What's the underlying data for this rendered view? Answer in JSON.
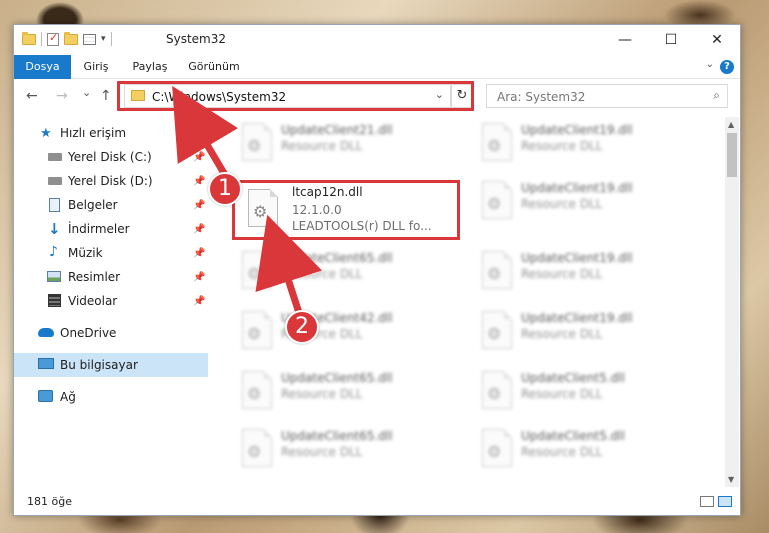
{
  "window": {
    "title": "System32"
  },
  "titlebar": {
    "minimize_glyph": "—",
    "maximize_glyph": "☐",
    "close_glyph": "✕"
  },
  "ribbon": {
    "tabs": [
      "Dosya",
      "Giriş",
      "Paylaş",
      "Görünüm"
    ],
    "help_glyph": "?"
  },
  "nav": {
    "back_glyph": "←",
    "forward_glyph": "→",
    "recent_glyph": "⌄",
    "up_glyph": "↑",
    "address": "C:\\Windows\\System32",
    "address_dropdown_glyph": "⌄",
    "refresh_glyph": "↻",
    "search_placeholder": "Ara: System32",
    "search_glyph": "⌕"
  },
  "sidebar": {
    "items": [
      {
        "label": "Hızlı erişim",
        "icon": "star-icon",
        "pinned": false
      },
      {
        "label": "Yerel Disk (C:)",
        "icon": "drive-icon",
        "pinned": true
      },
      {
        "label": "Yerel Disk (D:)",
        "icon": "drive-icon",
        "pinned": true
      },
      {
        "label": "Belgeler",
        "icon": "documents-icon",
        "pinned": true
      },
      {
        "label": "İndirmeler",
        "icon": "download-icon",
        "pinned": true
      },
      {
        "label": "Müzik",
        "icon": "music-icon",
        "pinned": true
      },
      {
        "label": "Resimler",
        "icon": "pictures-icon",
        "pinned": true
      },
      {
        "label": "Videolar",
        "icon": "videos-icon",
        "pinned": true
      },
      {
        "label": "OneDrive",
        "icon": "cloud-icon",
        "pinned": false
      },
      {
        "label": "Bu bilgisayar",
        "icon": "computer-icon",
        "pinned": false,
        "selected": true
      },
      {
        "label": "Ağ",
        "icon": "network-icon",
        "pinned": false
      }
    ],
    "pin_glyph": "📌"
  },
  "files": {
    "highlighted": {
      "name": "ltcap12n.dll",
      "version": "12.1.0.0",
      "description": "LEADTOOLS(r) DLL fo..."
    },
    "left_column": [
      {
        "name": "UpdateClient21.dll",
        "type": "Resource DLL"
      },
      {
        "name": "UpdateClient65.dll",
        "type": "Resource DLL"
      },
      {
        "name": "UpdateClient42.dll",
        "type": "Resource DLL"
      },
      {
        "name": "UpdateClient65.dll",
        "type": "Resource DLL"
      },
      {
        "name": "UpdateClient65.dll",
        "type": "Resource DLL"
      }
    ],
    "right_column": [
      {
        "name": "UpdateClient19.dll",
        "type": "Resource DLL"
      },
      {
        "name": "UpdateClient19.dll",
        "type": "Resource DLL"
      },
      {
        "name": "UpdateClient19.dll",
        "type": "Resource DLL"
      },
      {
        "name": "UpdateClient19.dll",
        "type": "Resource DLL"
      },
      {
        "name": "UpdateClient5.dll",
        "type": "Resource DLL"
      },
      {
        "name": "UpdateClient5.dll",
        "type": "Resource DLL"
      }
    ]
  },
  "status": {
    "count": "181 öğe"
  },
  "callouts": [
    "1",
    "2"
  ],
  "colors": {
    "accent": "#1979ca",
    "highlight": "#d9373a",
    "selected_bg": "#cce4f7"
  }
}
